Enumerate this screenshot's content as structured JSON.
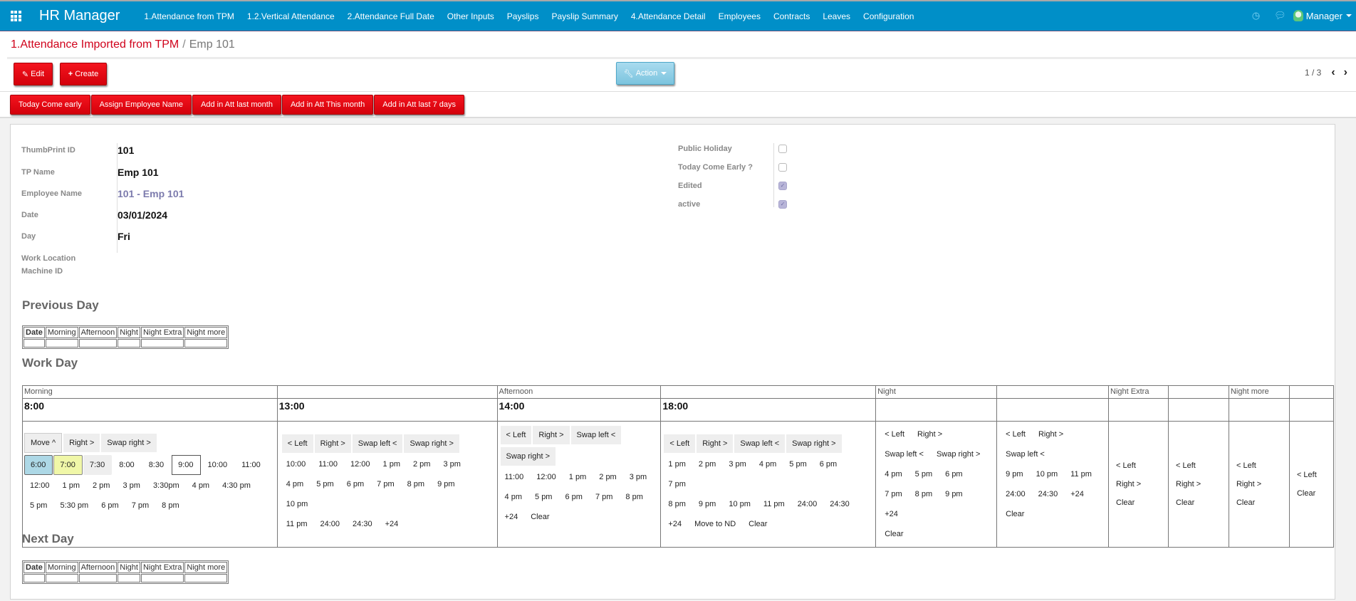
{
  "topbar": {
    "apps_icon": "apps-grid-icon",
    "brand": "HR Manager",
    "nav": [
      "1.Attendance from TPM",
      "1.2.Vertical Attendance",
      "2.Attendance Full Date",
      "Other Inputs",
      "Payslips",
      "Payslip Summary",
      "4.Attendance Detail",
      "Employees",
      "Contracts",
      "Leaves",
      "Configuration"
    ],
    "activity_icon": "clock-icon",
    "chat_icon": "chat-icon",
    "user": "Manager"
  },
  "colors": {
    "topbar": "#008fc8",
    "primary_button": "#e60012",
    "action_button": "#8dcde5",
    "breadcrumb_link": "#d0021b",
    "many2one_link": "#7c7bad"
  },
  "breadcrumb": {
    "parent": "1.Attendance Imported from TPM",
    "separator": "/",
    "current": "Emp 101"
  },
  "buttons": {
    "edit": "Edit",
    "create": "Create",
    "action": "Action"
  },
  "pager": {
    "value": "1 / 3",
    "prev": "‹",
    "next": "›"
  },
  "header_buttons": [
    "Today Come early",
    "Assign Employee Name",
    "Add in Att last month",
    "Add in Att This month",
    "Add in Att last 7 days"
  ],
  "form": {
    "left": [
      {
        "label": "ThumbPrint ID",
        "value": "101"
      },
      {
        "label": "TP Name",
        "value": "Emp 101"
      },
      {
        "label": "Employee Name",
        "value": "101 - Emp 101"
      },
      {
        "label": "Date",
        "value": "03/01/2024"
      },
      {
        "label": "Day",
        "value": "Fri"
      },
      {
        "label": "Work Location",
        "value": ""
      },
      {
        "label": "Machine ID",
        "value": ""
      }
    ],
    "right": [
      {
        "label": "Public Holiday",
        "checked": false
      },
      {
        "label": "Today Come Early ?",
        "checked": false
      },
      {
        "label": "Edited",
        "checked": true
      },
      {
        "label": "active",
        "checked": true
      }
    ]
  },
  "sections": {
    "previous_day": "Previous Day",
    "work_day": "Work Day",
    "next_day": "Next Day"
  },
  "day_table_headers": [
    "Date",
    "Morning",
    "Afternoon",
    "Night",
    "Night Extra",
    "Night more"
  ],
  "work_day": {
    "headers": [
      "Morning",
      "",
      "Afternoon",
      "",
      "Night",
      "",
      "Night Extra",
      "",
      "Night more",
      ""
    ],
    "times": [
      "8:00",
      "13:00",
      "14:00",
      "18:00",
      "",
      "",
      "",
      "",
      "",
      ""
    ],
    "col1": {
      "controls": [
        "Move ^",
        "Right >",
        "Swap right >"
      ],
      "slots": [
        "6:00",
        "7:00",
        "7:30",
        "8:00",
        "8:30",
        "9:00",
        "10:00",
        "11:00",
        "12:00",
        "1 pm",
        "2 pm",
        "3 pm",
        "3:30pm",
        "4 pm",
        "4:30 pm",
        "5 pm",
        "5:30 pm",
        "6 pm",
        "7 pm",
        "8 pm"
      ]
    },
    "col2": {
      "controls": [
        "< Left",
        "Right >",
        "Swap left <",
        "Swap right >"
      ],
      "slots": [
        "10:00",
        "11:00",
        "12:00",
        "1 pm",
        "2 pm",
        "3 pm",
        "4 pm",
        "5 pm",
        "6 pm",
        "7 pm",
        "8 pm",
        "9 pm",
        "10 pm",
        "11 pm",
        "24:00",
        "24:30",
        "+24"
      ]
    },
    "col3": {
      "controls": [
        "< Left",
        "Right >",
        "Swap left <",
        "Swap right >"
      ],
      "slots": [
        "11:00",
        "12:00",
        "1 pm",
        "2 pm",
        "3 pm",
        "4 pm",
        "5 pm",
        "6 pm",
        "7 pm",
        "8 pm",
        "+24",
        "Clear"
      ]
    },
    "col4": {
      "controls": [
        "< Left",
        "Right >",
        "Swap left <",
        "Swap right >"
      ],
      "slots": [
        "1 pm",
        "2 pm",
        "3 pm",
        "4 pm",
        "5 pm",
        "6 pm",
        "7 pm",
        "8 pm",
        "9 pm",
        "10 pm",
        "11 pm",
        "24:00",
        "24:30",
        "+24",
        "Move to ND",
        "Clear"
      ]
    },
    "col5": {
      "controls": [
        "< Left",
        "Right >",
        "Swap left <",
        "Swap right >"
      ],
      "slots": [
        "4 pm",
        "5 pm",
        "6 pm",
        "7 pm",
        "8 pm",
        "9 pm",
        "+24",
        "Clear"
      ]
    },
    "col6": {
      "controls": [
        "< Left",
        "Right >",
        "Swap left <"
      ],
      "slots": [
        "9 pm",
        "10 pm",
        "11 pm",
        "24:00",
        "24:30",
        "+24",
        "Clear"
      ]
    },
    "col7": [
      "< Left",
      "Right >",
      "Clear"
    ],
    "col8": [
      "< Left",
      "Right >",
      "Clear"
    ],
    "col9": [
      "< Left",
      "Right >",
      "Clear"
    ],
    "col10": [
      "< Left",
      "Clear"
    ]
  }
}
